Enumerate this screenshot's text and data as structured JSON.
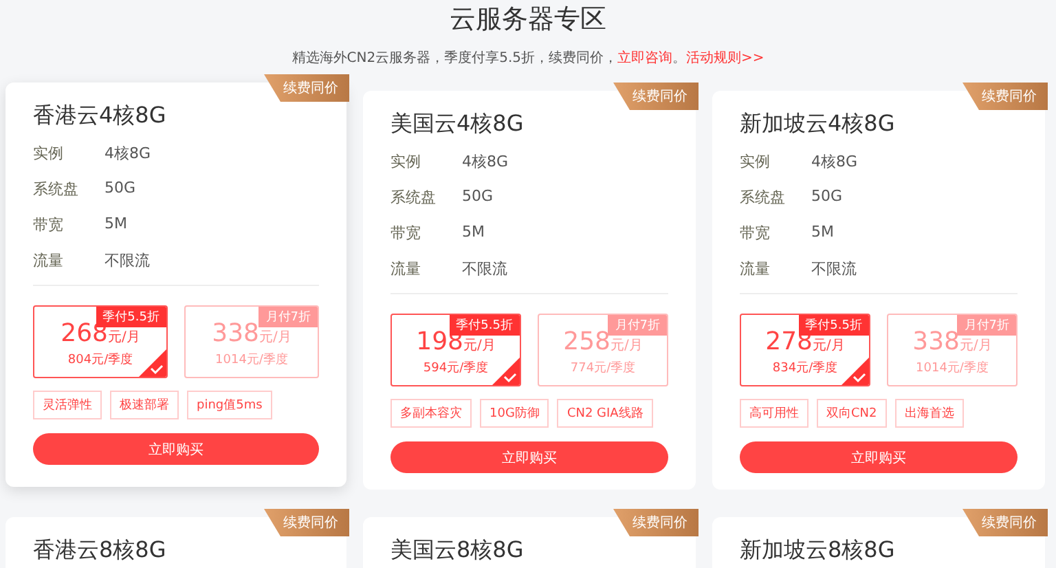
{
  "header": {
    "title": "云服务器专区",
    "subtitle": "精选海外CN2云服务器，季度付享5.5折，续费同价，",
    "consult_link": "立即咨询",
    "separator": "。",
    "rules_link": "活动规则>>"
  },
  "cards": [
    {
      "title": "香港云4核8G",
      "badge": "续费同价",
      "raised": true,
      "specs": [
        {
          "label": "实例",
          "value": "4核8G"
        },
        {
          "label": "系统盘",
          "value": "50G"
        },
        {
          "label": "带宽",
          "value": "5M"
        },
        {
          "label": "流量",
          "value": "不限流"
        }
      ],
      "plans": [
        {
          "tag": "季付5.5折",
          "price": "268",
          "unit": "元/月",
          "total": "804元/季度",
          "selected": true
        },
        {
          "tag": "月付7折",
          "price": "338",
          "unit": "元/月",
          "total": "1014元/季度",
          "selected": false
        }
      ],
      "features": [
        "灵活弹性",
        "极速部署",
        "ping值5ms"
      ],
      "button": "立即购买"
    },
    {
      "title": "美国云4核8G",
      "badge": "续费同价",
      "raised": false,
      "specs": [
        {
          "label": "实例",
          "value": "4核8G"
        },
        {
          "label": "系统盘",
          "value": "50G"
        },
        {
          "label": "带宽",
          "value": "5M"
        },
        {
          "label": "流量",
          "value": "不限流"
        }
      ],
      "plans": [
        {
          "tag": "季付5.5折",
          "price": "198",
          "unit": "元/月",
          "total": "594元/季度",
          "selected": true
        },
        {
          "tag": "月付7折",
          "price": "258",
          "unit": "元/月",
          "total": "774元/季度",
          "selected": false
        }
      ],
      "features": [
        "多副本容灾",
        "10G防御",
        "CN2 GIA线路"
      ],
      "button": "立即购买"
    },
    {
      "title": "新加坡云4核8G",
      "badge": "续费同价",
      "raised": false,
      "specs": [
        {
          "label": "实例",
          "value": "4核8G"
        },
        {
          "label": "系统盘",
          "value": "50G"
        },
        {
          "label": "带宽",
          "value": "5M"
        },
        {
          "label": "流量",
          "value": "不限流"
        }
      ],
      "plans": [
        {
          "tag": "季付5.5折",
          "price": "278",
          "unit": "元/月",
          "total": "834元/季度",
          "selected": true
        },
        {
          "tag": "月付7折",
          "price": "338",
          "unit": "元/月",
          "total": "1014元/季度",
          "selected": false
        }
      ],
      "features": [
        "高可用性",
        "双向CN2",
        "出海首选"
      ],
      "button": "立即购买"
    },
    {
      "title": "香港云8核8G",
      "badge": "续费同价",
      "raised": false
    },
    {
      "title": "美国云8核8G",
      "badge": "续费同价",
      "raised": false
    },
    {
      "title": "新加坡云8核8G",
      "badge": "续费同价",
      "raised": false
    }
  ]
}
